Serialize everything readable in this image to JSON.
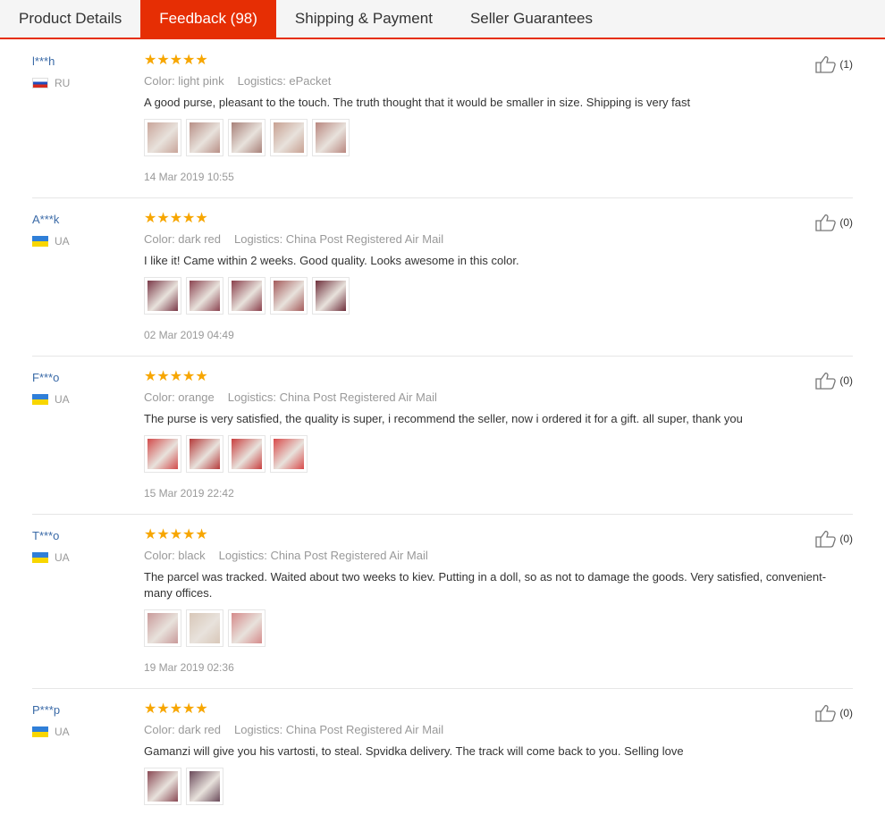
{
  "tabs": [
    {
      "label": "Product Details"
    },
    {
      "label": "Feedback (98)"
    },
    {
      "label": "Shipping & Payment"
    },
    {
      "label": "Seller Guarantees"
    }
  ],
  "reviews": [
    {
      "user": "l***h",
      "country": "RU",
      "stars": "★★★★★",
      "color": "Color: light pink",
      "logistics": "Logistics: ePacket",
      "text": "A good purse, pleasant to the touch. The truth thought that it would be smaller in size. Shipping is very fast",
      "date": "14 Mar 2019 10:55",
      "helpful": "(1)",
      "photo_colors": [
        "#c9a59a",
        "#b88f86",
        "#a88078",
        "#c7a091",
        "#b9877f"
      ]
    },
    {
      "user": "A***k",
      "country": "UA",
      "stars": "★★★★★",
      "color": "Color: dark red",
      "logistics": "Logistics: China Post Registered Air Mail",
      "text": "I like it! Came within 2 weeks. Good quality. Looks awesome in this color.",
      "date": "02 Mar 2019 04:49",
      "helpful": "(0)",
      "photo_colors": [
        "#7a3948",
        "#8b4451",
        "#8a3f4b",
        "#a45a5a",
        "#6e2f3b"
      ]
    },
    {
      "user": "F***o",
      "country": "UA",
      "stars": "★★★★★",
      "color": "Color: orange",
      "logistics": "Logistics: China Post Registered Air Mail",
      "text": "The purse is very satisfied, the quality is super, i recommend the seller, now i ordered it for a gift. all super, thank you",
      "date": "15 Mar 2019 22:42",
      "helpful": "(0)",
      "photo_colors": [
        "#d24b4b",
        "#b53a3a",
        "#c83f3f",
        "#d84a4a"
      ]
    },
    {
      "user": "T***o",
      "country": "UA",
      "stars": "★★★★★",
      "color": "Color: black",
      "logistics": "Logistics: China Post Registered Air Mail",
      "text": "The parcel was tracked. Waited about two weeks to kiev. Putting in a doll, so as not to damage the goods. Very satisfied, convenient-many offices.",
      "date": "19 Mar 2019 02:36",
      "helpful": "(0)",
      "photo_colors": [
        "#c99a9a",
        "#d8c7b8",
        "#d58a8a"
      ]
    },
    {
      "user": "P***p",
      "country": "UA",
      "stars": "★★★★★",
      "color": "Color: dark red",
      "logistics": "Logistics: China Post Registered Air Mail",
      "text": "Gamanzi will give you his vartosti, to steal. Spvidka delivery. The track will come back to you. Selling love",
      "date": "",
      "helpful": "(0)",
      "photo_colors": [
        "#8a4a55",
        "#6a4a5a"
      ]
    }
  ],
  "colors": {
    "accent": "#e62e04",
    "star": "#f7a600",
    "link": "#3a6aa7"
  }
}
